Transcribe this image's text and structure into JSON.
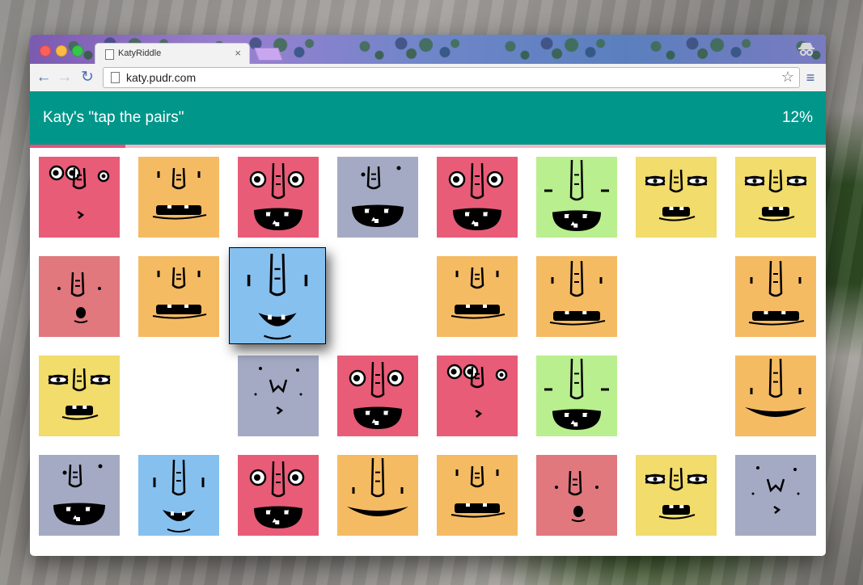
{
  "browser": {
    "tab_title": "KatyRiddle",
    "tab_close": "×",
    "url": "katy.pudr.com",
    "back_icon": "←",
    "forward_icon": "→",
    "reload_icon": "↻",
    "star_icon": "☆",
    "menu_icon": "≡"
  },
  "app": {
    "title": "Katy's \"tap the pairs\"",
    "progress_label": "12%",
    "progress_value": 0.12,
    "accent_color": "#00968a",
    "progress_color": "#e8517a"
  },
  "board": {
    "colors": {
      "pink": "#e85c78",
      "orange": "#f5bb63",
      "gray": "#a5aac4",
      "green": "#b9ef8e",
      "yellow": "#f1dc6c",
      "rose": "#e0787e",
      "blue": "#86c0ef"
    },
    "rows": [
      [
        {
          "color": "pink",
          "face": "a"
        },
        {
          "color": "orange",
          "face": "b"
        },
        {
          "color": "pink",
          "face": "c"
        },
        {
          "color": "gray",
          "face": "d"
        },
        {
          "color": "pink",
          "face": "c"
        },
        {
          "color": "green",
          "face": "e"
        },
        {
          "color": "yellow",
          "face": "f"
        },
        {
          "color": "yellow",
          "face": "f"
        }
      ],
      [
        {
          "color": "rose",
          "face": "g"
        },
        {
          "color": "orange",
          "face": "b"
        },
        {
          "color": "blue",
          "face": "h",
          "selected": true
        },
        null,
        {
          "color": "orange",
          "face": "b"
        },
        {
          "color": "orange",
          "face": "i"
        },
        null,
        {
          "color": "orange",
          "face": "i"
        }
      ],
      [
        {
          "color": "yellow",
          "face": "f"
        },
        null,
        {
          "color": "gray",
          "face": "j"
        },
        {
          "color": "pink",
          "face": "c"
        },
        {
          "color": "pink",
          "face": "a"
        },
        {
          "color": "green",
          "face": "e"
        },
        null,
        {
          "color": "orange",
          "face": "k"
        }
      ],
      [
        {
          "color": "gray",
          "face": "d"
        },
        {
          "color": "blue",
          "face": "h"
        },
        {
          "color": "pink",
          "face": "c"
        },
        {
          "color": "orange",
          "face": "k"
        },
        {
          "color": "orange",
          "face": "b"
        },
        {
          "color": "rose",
          "face": "g"
        },
        {
          "color": "yellow",
          "face": "f"
        },
        {
          "color": "gray",
          "face": "j"
        }
      ]
    ]
  }
}
